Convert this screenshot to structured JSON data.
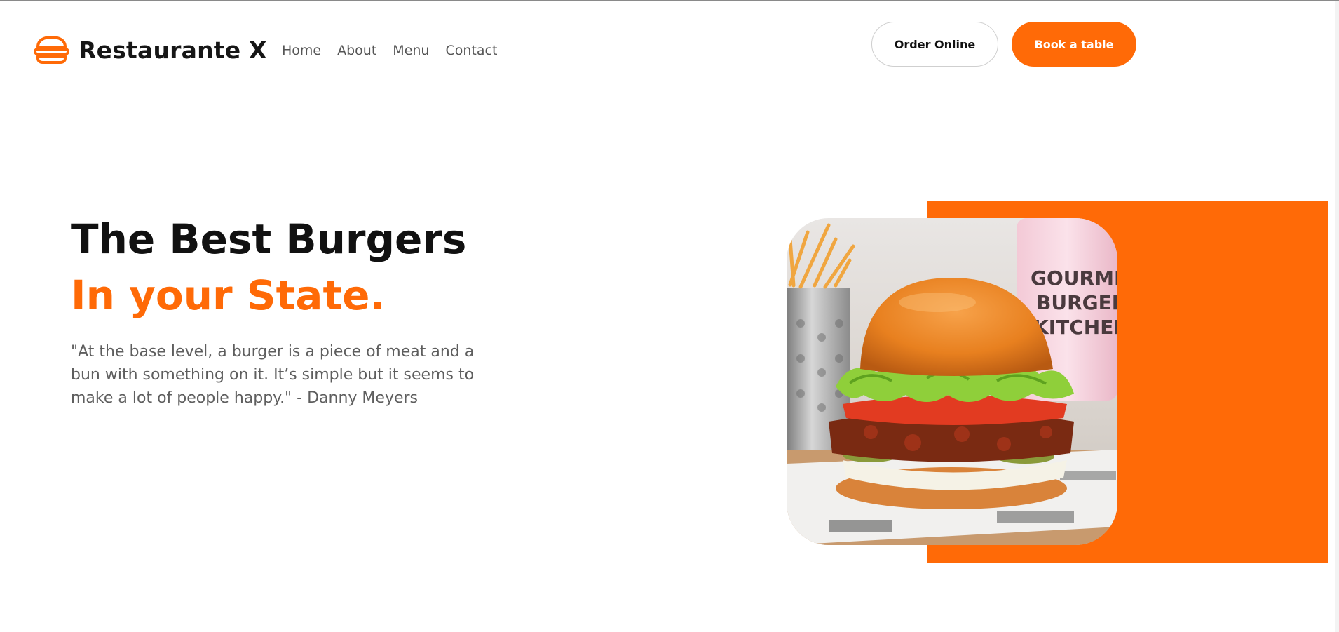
{
  "header": {
    "brand": "Restaurante X",
    "logo_icon": "burger-icon",
    "nav": [
      {
        "label": "Home"
      },
      {
        "label": "About"
      },
      {
        "label": "Menu"
      },
      {
        "label": "Contact"
      }
    ],
    "order_online_label": "Order Online",
    "book_table_label": "Book a table"
  },
  "hero": {
    "title_line1": "The Best Burgers",
    "title_line2": "In your State.",
    "quote": "\"At the base level, a burger is a piece of meat and a bun with something on it. It’s simple but it seems to make a lot of people happy.\" - Danny Meyers",
    "image_text": [
      "GOURMET",
      "BURGER",
      "KITCHEN"
    ]
  },
  "colors": {
    "accent": "#ff6a07",
    "heading": "#111111",
    "body_text": "#5e5e5e",
    "nav_text": "#555555"
  }
}
